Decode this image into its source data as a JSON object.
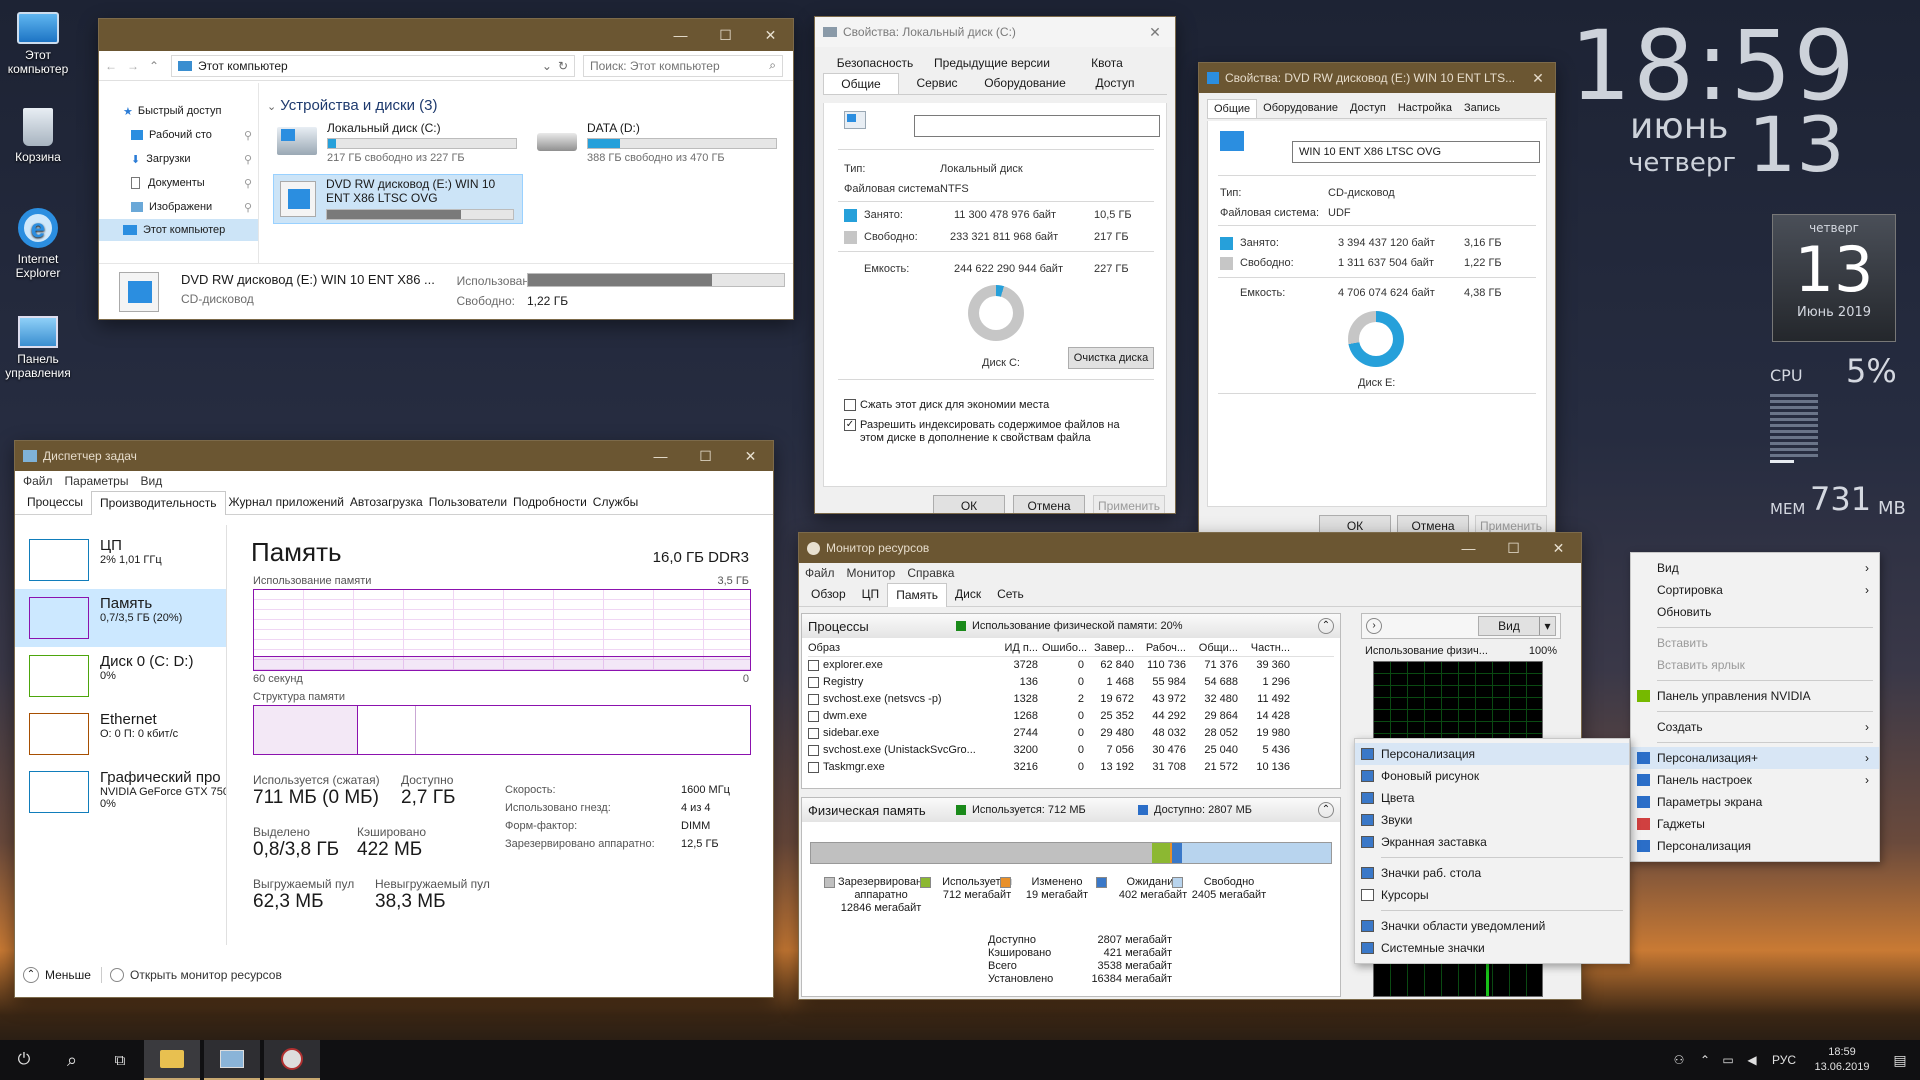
{
  "desktop": {
    "icons": [
      {
        "label": "Этот компьютер"
      },
      {
        "label": "Корзина"
      },
      {
        "label": "Internet Explorer"
      },
      {
        "label": "Панель управления"
      }
    ],
    "clock": {
      "time": "18:59",
      "month": "июнь",
      "day": "13",
      "weekday": "четверг"
    },
    "calendar": {
      "weekday": "четверг",
      "day": "13",
      "month_year": "Июнь 2019"
    },
    "meter": {
      "cpu_label": "CPU",
      "cpu_value": "5",
      "cpu_unit": "%",
      "cpu_fraction": 0.05,
      "mem_label": "MEM",
      "mem_value": "731",
      "mem_unit": "MB"
    }
  },
  "explorer": {
    "address": "Этот компьютер",
    "search_placeholder": "Поиск: Этот компьютер",
    "nav": [
      {
        "label": "Быстрый доступ"
      },
      {
        "label": "Рабочий сто"
      },
      {
        "label": "Загрузки"
      },
      {
        "label": "Документы"
      },
      {
        "label": "Изображени"
      },
      {
        "label": "Этот компьютер"
      }
    ],
    "section": "Устройства и диски (3)",
    "drives": [
      {
        "name": "Локальный диск (C:)",
        "free": "217 ГБ свободно из 227 ГБ",
        "used_fraction": 0.04
      },
      {
        "name": "DATA (D:)",
        "free": "388 ГБ свободно из 470 ГБ",
        "used_fraction": 0.17
      },
      {
        "name": "DVD RW дисковод (E:) WIN 10 ENT X86 LTSC OVG",
        "free": "",
        "used_fraction": 0.72
      }
    ],
    "details": {
      "name": "DVD RW дисковод (E:) WIN 10 ENT X86 ...",
      "type": "CD-дисковод",
      "used_label": "Использовано:",
      "free_label": "Свободно:",
      "free_value": "1,22 ГБ",
      "used_fraction": 0.72
    }
  },
  "propsC": {
    "title": "Свойства: Локальный диск (C:)",
    "tabs_top": [
      "Безопасность",
      "Предыдущие версии",
      "Квота"
    ],
    "tabs_bottom": [
      "Общие",
      "Сервис",
      "Оборудование",
      "Доступ"
    ],
    "type_label": "Тип:",
    "type_value": "Локальный диск",
    "fs_label": "Файловая система:",
    "fs_value": "NTFS",
    "used_label": "Занято:",
    "used_bytes": "11 300 478 976 байт",
    "used_size": "10,5 ГБ",
    "free_label": "Свободно:",
    "free_bytes": "233 321 811 968 байт",
    "free_size": "217 ГБ",
    "cap_label": "Емкость:",
    "cap_bytes": "244 622 290 944 байт",
    "cap_size": "227 ГБ",
    "disk_label": "Диск C:",
    "cleanup": "Очистка диска",
    "compress": "Сжать этот диск для экономии места",
    "index": "Разрешить индексировать содержимое файлов на этом диске в дополнение к свойствам файла",
    "ok": "ОК",
    "cancel": "Отмена",
    "apply": "Применить",
    "used_fraction": 0.046,
    "colors": {
      "used": "#26a0da",
      "free": "#c6c6c6"
    }
  },
  "propsE": {
    "title": "Свойства: DVD RW дисковод (E:) WIN 10 ENT LTS...",
    "tabs": [
      "Общие",
      "Оборудование",
      "Доступ",
      "Настройка",
      "Запись"
    ],
    "name_value": "WIN 10 ENT X86 LTSC OVG",
    "type_label": "Тип:",
    "type_value": "CD-дисковод",
    "fs_label": "Файловая система:",
    "fs_value": "UDF",
    "used_label": "Занято:",
    "used_bytes": "3 394 437 120 байт",
    "used_size": "3,16 ГБ",
    "free_label": "Свободно:",
    "free_bytes": "1 311 637 504 байт",
    "free_size": "1,22 ГБ",
    "cap_label": "Емкость:",
    "cap_bytes": "4 706 074 624 байт",
    "cap_size": "4,38 ГБ",
    "disk_label": "Диск E:",
    "ok": "ОК",
    "cancel": "Отмена",
    "apply": "Применить",
    "used_fraction": 0.72
  },
  "taskmgr": {
    "title": "Диспетчер задач",
    "menu": [
      "Файл",
      "Параметры",
      "Вид"
    ],
    "tabs": [
      "Процессы",
      "Производительность",
      "Журнал приложений",
      "Автозагрузка",
      "Пользователи",
      "Подробности",
      "Службы"
    ],
    "cats": [
      {
        "name": "ЦП",
        "sub1": "2% 1,01 ГГц",
        "sub2": ""
      },
      {
        "name": "Память",
        "sub1": "0,7/3,5 ГБ (20%)",
        "sub2": ""
      },
      {
        "name": "Диск 0 (C: D:)",
        "sub1": "0%",
        "sub2": ""
      },
      {
        "name": "Ethernet",
        "sub1": "О: 0 П: 0 кбит/с",
        "sub2": ""
      },
      {
        "name": "Графический про",
        "sub1": "NVIDIA GeForce GTX 750",
        "sub2": "0%"
      }
    ],
    "heading": "Память",
    "spec": "16,0 ГБ DDR3",
    "usage_label": "Использование памяти",
    "usage_max": "3,5 ГБ",
    "axis_left": "60 секунд",
    "axis_right": "0",
    "struct_label": "Структура памяти",
    "stats": [
      {
        "label": "Используется (сжатая)",
        "value": "711 МБ (0 МБ)"
      },
      {
        "label": "Доступно",
        "value": "2,7 ГБ"
      },
      {
        "label": "Выделено",
        "value": "0,8/3,8 ГБ"
      },
      {
        "label": "Кэшировано",
        "value": "422 МБ"
      },
      {
        "label": "Выгружаемый пул",
        "value": "62,3 МБ"
      },
      {
        "label": "Невыгружаемый пул",
        "value": "38,3 МБ"
      }
    ],
    "right_stats": [
      {
        "label": "Скорость:",
        "value": "1600 МГц"
      },
      {
        "label": "Использовано гнезд:",
        "value": "4 из 4"
      },
      {
        "label": "Форм-фактор:",
        "value": "DIMM"
      },
      {
        "label": "Зарезервировано аппаратно:",
        "value": "12,5 ГБ"
      }
    ],
    "footer_less": "Меньше",
    "footer_link": "Открыть монитор ресурсов"
  },
  "resmon": {
    "title": "Монитор ресурсов",
    "menu": [
      "Файл",
      "Монитор",
      "Справка"
    ],
    "tabs": [
      "Обзор",
      "ЦП",
      "Память",
      "Диск",
      "Сеть"
    ],
    "proc_header": "Процессы",
    "proc_usage": "Использование физической памяти: 20%",
    "columns": [
      "Образ",
      "ИД п...",
      "Ошибо...",
      "Завер...",
      "Рабоч...",
      "Общи...",
      "Частн..."
    ],
    "rows": [
      [
        "explorer.exe",
        "3728",
        "0",
        "62 840",
        "110 736",
        "71 376",
        "39 360"
      ],
      [
        "Registry",
        "136",
        "0",
        "1 468",
        "55 984",
        "54 688",
        "1 296"
      ],
      [
        "svchost.exe (netsvcs -p)",
        "1328",
        "2",
        "19 672",
        "43 972",
        "32 480",
        "11 492"
      ],
      [
        "dwm.exe",
        "1268",
        "0",
        "25 352",
        "44 292",
        "29 864",
        "14 428"
      ],
      [
        "sidebar.exe",
        "2744",
        "0",
        "29 480",
        "48 032",
        "28 052",
        "19 980"
      ],
      [
        "svchost.exe (UnistackSvcGro...",
        "3200",
        "0",
        "7 056",
        "30 476",
        "25 040",
        "5 436"
      ],
      [
        "Taskmgr.exe",
        "3216",
        "0",
        "13 192",
        "31 708",
        "21 572",
        "10 136"
      ]
    ],
    "phys_header": "Физическая память",
    "phys_used": "Используется: 712 МБ",
    "phys_avail": "Доступно: 2807 МБ",
    "legend": [
      {
        "name": "Зарезервировано аппаратно",
        "value": "12846 мегабайт",
        "color": "#c0c0c0"
      },
      {
        "name": "Используется",
        "value": "712 мегабайт",
        "color": "#8cb832"
      },
      {
        "name": "Изменено",
        "value": "19 мегабайт",
        "color": "#e8902a"
      },
      {
        "name": "Ожидание",
        "value": "402 мегабайт",
        "color": "#3a78c8"
      },
      {
        "name": "Свободно",
        "value": "2405 мегабайт",
        "color": "#b8d4ee"
      }
    ],
    "totals": [
      {
        "label": "Доступно",
        "value": "2807 мегабайт"
      },
      {
        "label": "Кэшировано",
        "value": "421 мегабайт"
      },
      {
        "label": "Всего",
        "value": "3538 мегабайт"
      },
      {
        "label": "Установлено",
        "value": "16384 мегабайт"
      }
    ],
    "side_view": "Вид",
    "side_label": "Использование физич...",
    "side_pct": "100%"
  },
  "context_menu": {
    "items": [
      {
        "label": "Вид",
        "arrow": true
      },
      {
        "label": "Сортировка",
        "arrow": true
      },
      {
        "label": "Обновить"
      },
      {
        "label": "Вставить",
        "disabled": true
      },
      {
        "label": "Вставить ярлык",
        "disabled": true
      },
      {
        "label": "Панель управления NVIDIA"
      },
      {
        "label": "Создать",
        "arrow": true
      },
      {
        "label": "Персонализация+",
        "arrow": true
      },
      {
        "label": "Панель настроек",
        "arrow": true
      },
      {
        "label": "Параметры экрана"
      },
      {
        "label": "Гаджеты"
      },
      {
        "label": "Персонализация"
      }
    ],
    "submenu": [
      {
        "label": "Персонализация"
      },
      {
        "label": "Фоновый рисунок"
      },
      {
        "label": "Цвета"
      },
      {
        "label": "Звуки"
      },
      {
        "label": "Экранная заставка"
      },
      {
        "label": "Значки раб. стола"
      },
      {
        "label": "Курсоры"
      },
      {
        "label": "Значки области уведомлений"
      },
      {
        "label": "Системные значки"
      }
    ]
  },
  "taskbar": {
    "lang": "РУС",
    "time": "18:59",
    "date": "13.06.2019"
  }
}
